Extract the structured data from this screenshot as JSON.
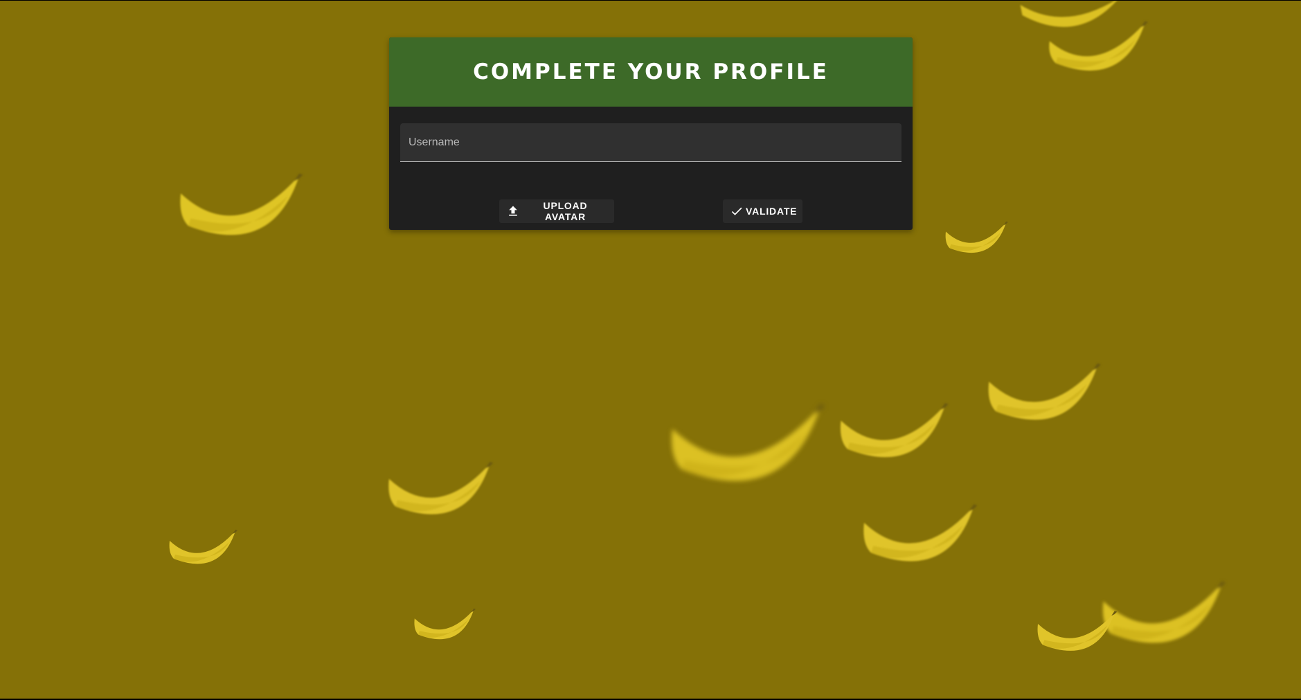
{
  "profile_form": {
    "title": "Complete your profile",
    "username_placeholder": "Username",
    "upload_avatar_label": "UPLOAD AVATAR",
    "validate_label": "VALIDATE",
    "upload_icon": "upload-icon",
    "validate_icon": "check-icon"
  },
  "colors": {
    "background": "#857107",
    "header": "#3d6a28",
    "card": "#1f1f1f",
    "banana": "#e0c42a"
  }
}
